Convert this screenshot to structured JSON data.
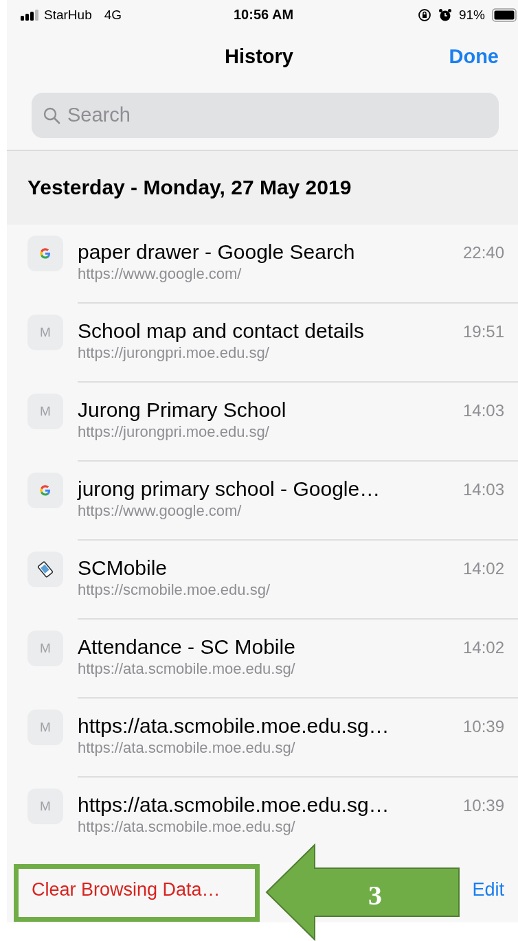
{
  "status_bar": {
    "carrier": "StarHub",
    "network": "4G",
    "time": "10:56 AM",
    "battery": "91%"
  },
  "nav": {
    "title": "History",
    "done": "Done"
  },
  "search": {
    "placeholder": "Search"
  },
  "section": {
    "title": "Yesterday - Monday, 27 May 2019"
  },
  "items": [
    {
      "icon": {
        "kind": "google"
      },
      "title": "paper drawer - Google Search",
      "url": "https://www.google.com/",
      "time": "22:40"
    },
    {
      "icon": {
        "kind": "letter",
        "letter": "M"
      },
      "title": "School map and contact details",
      "url": "https://jurongpri.moe.edu.sg/",
      "time": "19:51"
    },
    {
      "icon": {
        "kind": "letter",
        "letter": "M"
      },
      "title": "Jurong Primary School",
      "url": "https://jurongpri.moe.edu.sg/",
      "time": "14:03"
    },
    {
      "icon": {
        "kind": "google"
      },
      "title": "jurong primary school - Google…",
      "url": "https://www.google.com/",
      "time": "14:03"
    },
    {
      "icon": {
        "kind": "app"
      },
      "title": "SCMobile",
      "url": "https://scmobile.moe.edu.sg/",
      "time": "14:02"
    },
    {
      "icon": {
        "kind": "letter",
        "letter": "M"
      },
      "title": "Attendance - SC Mobile",
      "url": "https://ata.scmobile.moe.edu.sg/",
      "time": "14:02"
    },
    {
      "icon": {
        "kind": "letter",
        "letter": "M"
      },
      "title": "https://ata.scmobile.moe.edu.sg…",
      "url": "https://ata.scmobile.moe.edu.sg/",
      "time": "10:39"
    },
    {
      "icon": {
        "kind": "letter",
        "letter": "M"
      },
      "title": "https://ata.scmobile.moe.edu.sg…",
      "url": "https://ata.scmobile.moe.edu.sg/",
      "time": "10:39"
    }
  ],
  "toolbar": {
    "clear": "Clear Browsing Data…",
    "edit": "Edit"
  },
  "annotation": {
    "step": "3"
  }
}
